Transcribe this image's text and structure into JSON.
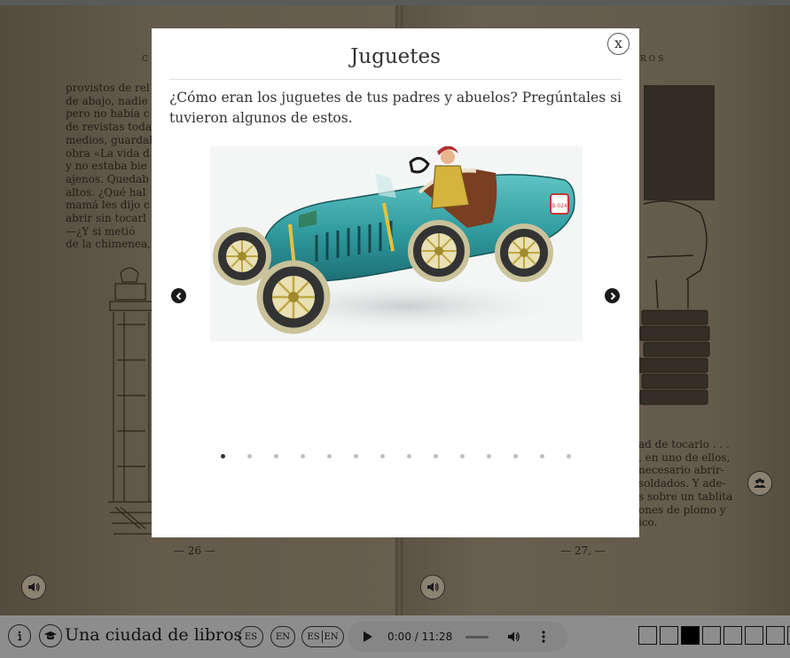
{
  "book": {
    "left_running_head": "C",
    "right_running_head": "ROS",
    "left_text": "provistos de rel\nde abajo, nadie l\npero no había c\nde revistas toda\nmedios, guardal\nobra «La vida d\ny no estaba bie\najenos. Quedab\naltos. ¿Qué hal\nmamá les dijo c\nabrir sin tocarl\n—¿Y si metió\nde la chimenea,",
    "right_text": "ad de tocarlo . . .\n, en uno de ellos,\nnecesario abrir-\nsoldados. Y ade-\ns sobre un tablita\nones de plomo y\nico.",
    "left_page_number": "— 26 —",
    "right_page_number": "— 27, —"
  },
  "modal": {
    "title": "Juguetes",
    "close_label": "x",
    "prompt": "¿Cómo eran los juguetes de tus padres y abuelos? Pregúntales si tuvieron algunos de estos.",
    "car_plate": "B-024",
    "slide_count": 14,
    "active_slide": 1
  },
  "bottombar": {
    "title": "Una ciudad de libros",
    "lang_es": "ES",
    "lang_en": "EN",
    "lang_es_both": "ES",
    "lang_en_both": "EN",
    "audio_time": "0:00 / 11:28",
    "thumbnails": 8,
    "active_thumbnail": 3
  },
  "icons": {
    "info": "info-icon",
    "graduation": "graduation-cap-icon",
    "speaker_left": "speaker-icon",
    "speaker_right": "speaker-icon",
    "group": "group-icon",
    "prev": "chevron-left-icon",
    "next": "chevron-right-icon",
    "play": "play-icon",
    "volume": "volume-icon",
    "more": "more-vertical-icon"
  },
  "colors": {
    "modal_bg": "#ffffff",
    "bar_bg": "#8d8d8d",
    "car_teal": "#2f9a9e"
  }
}
